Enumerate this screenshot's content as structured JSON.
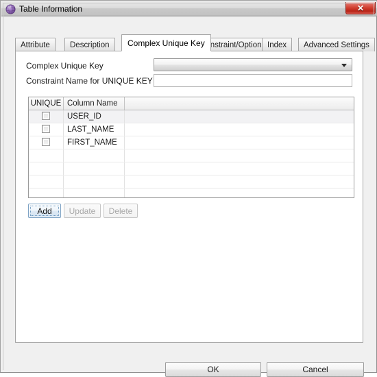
{
  "window": {
    "title": "Table Information",
    "icon": "database-sphere-icon",
    "close_label": "✕",
    "accent_close_color": "#cf3b2c",
    "titlebar_color": "#dcdcdc",
    "dialog_background": "#f0f0f0"
  },
  "tabs": [
    {
      "label": "Attribute",
      "active": false
    },
    {
      "label": "Description",
      "active": false
    },
    {
      "label": "Complex Unique Key",
      "active": true
    },
    {
      "label": "Constraint/Option",
      "active": false
    },
    {
      "label": "Index",
      "active": false
    },
    {
      "label": "Advanced Settings",
      "active": false
    }
  ],
  "form": {
    "complex_unique_key": {
      "label": "Complex Unique Key",
      "value": "",
      "placeholder": "",
      "options": []
    },
    "constraint_name": {
      "label": "Constraint Name for UNIQUE KEY",
      "value": "",
      "placeholder": ""
    }
  },
  "grid": {
    "columns": [
      "UNIQUE",
      "Column Name",
      ""
    ],
    "rows": [
      {
        "unique": false,
        "column_name": "USER_ID",
        "selected": true
      },
      {
        "unique": false,
        "column_name": "LAST_NAME",
        "selected": false
      },
      {
        "unique": false,
        "column_name": "FIRST_NAME",
        "selected": false
      }
    ],
    "empty_row_count": 4
  },
  "actions": {
    "add": {
      "label": "Add",
      "enabled": true,
      "focused": true
    },
    "update": {
      "label": "Update",
      "enabled": false,
      "focused": false
    },
    "delete": {
      "label": "Delete",
      "enabled": false,
      "focused": false
    }
  },
  "footer": {
    "ok": "OK",
    "cancel": "Cancel"
  }
}
